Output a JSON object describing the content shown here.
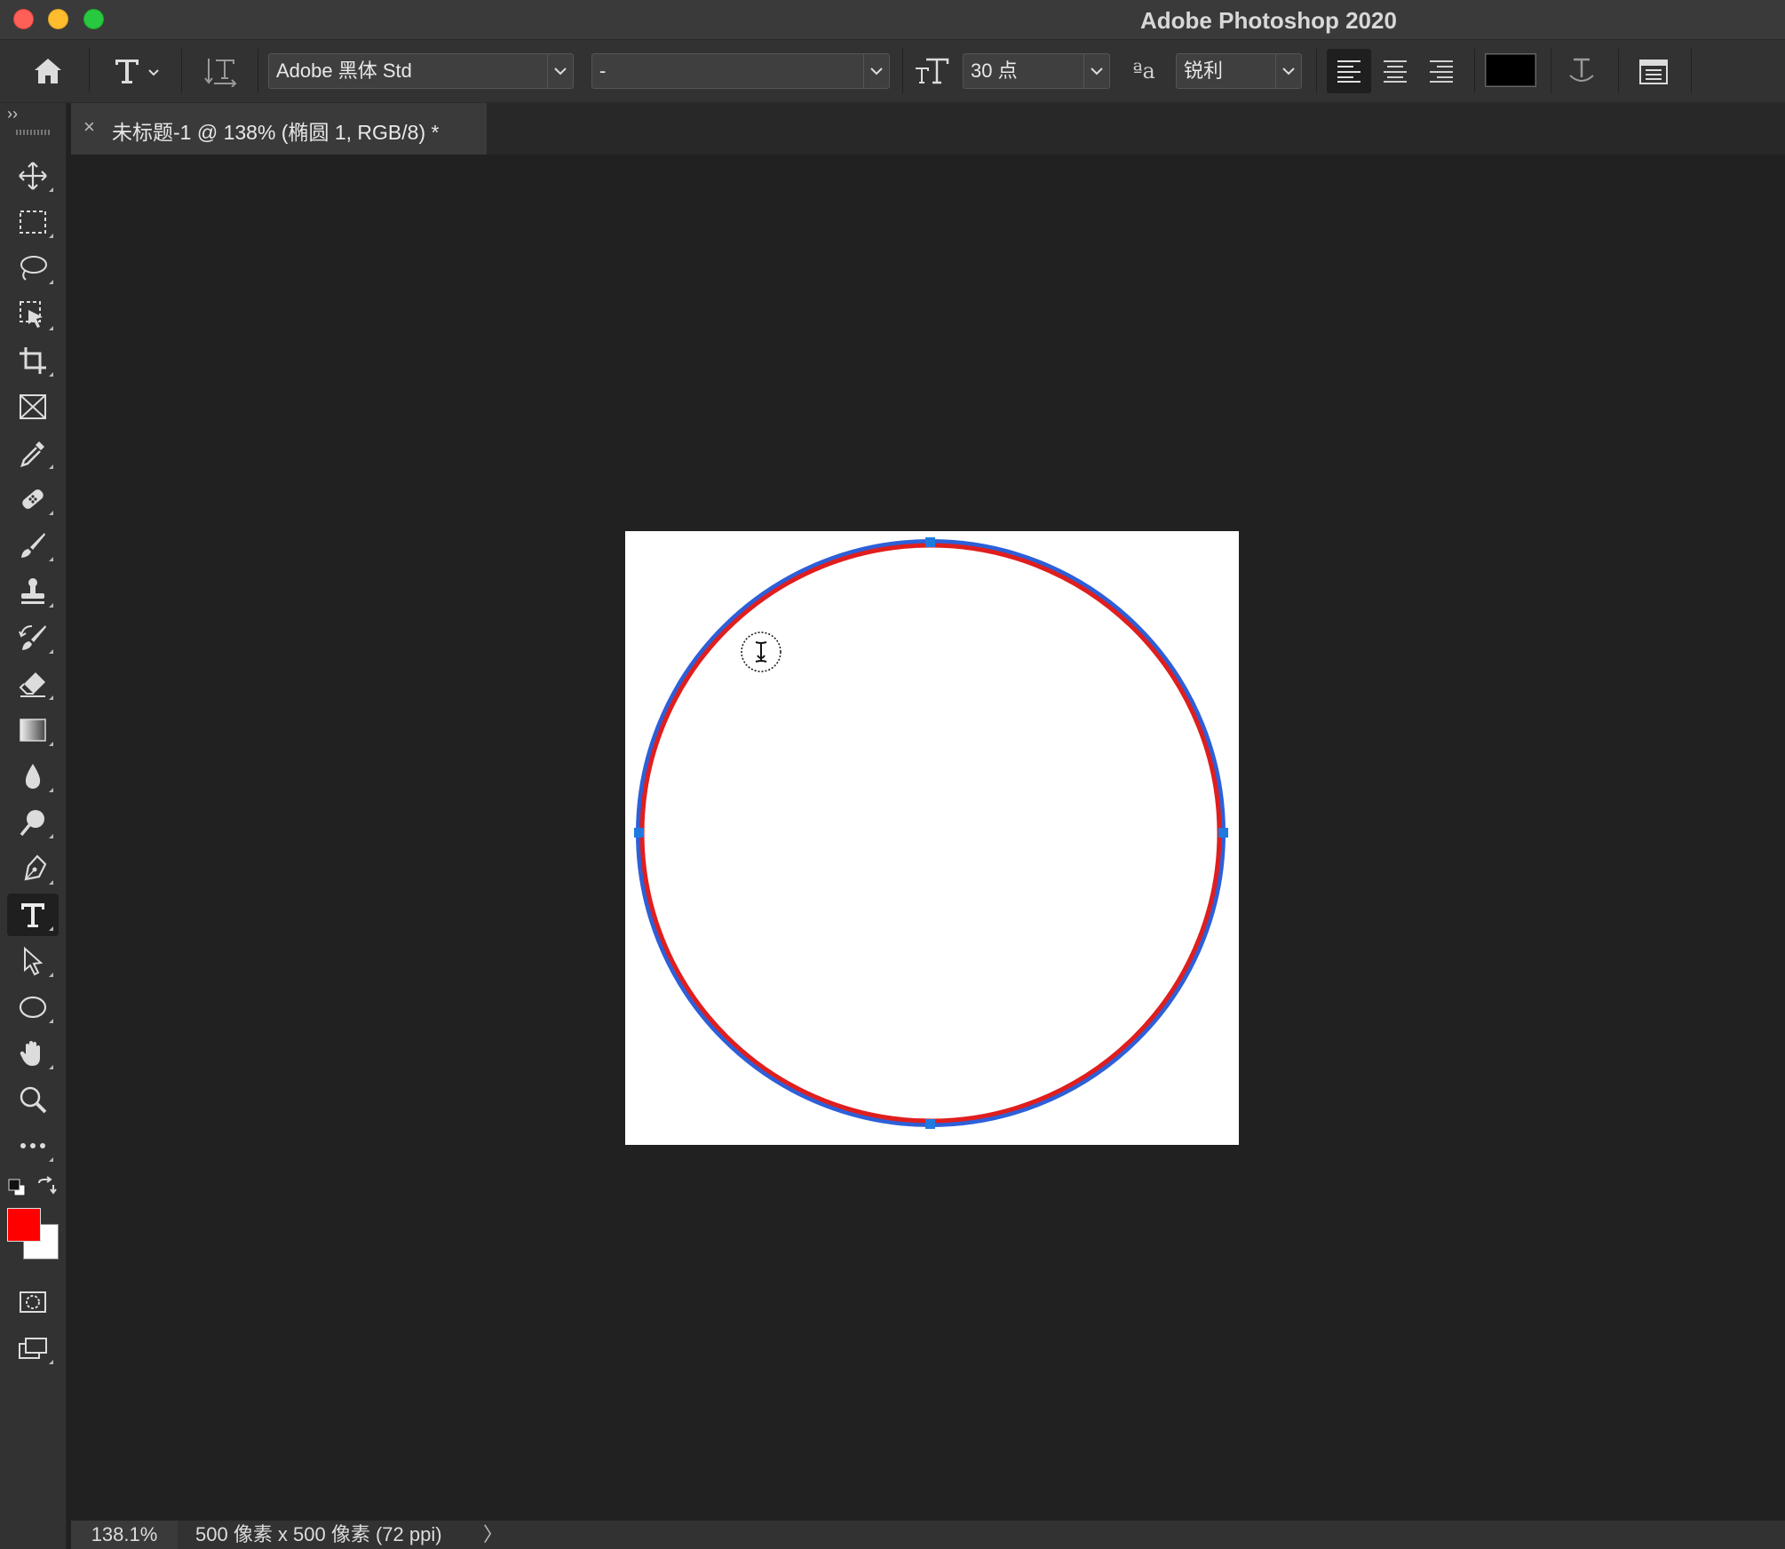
{
  "window": {
    "title": "Adobe Photoshop 2020"
  },
  "options_bar": {
    "font_family": "Adobe 黑体 Std",
    "font_style": "-",
    "font_size": "30 点",
    "antialias": "锐利",
    "text_color": "#000000"
  },
  "document_tab": {
    "close_glyph": "×",
    "title": "未标题-1 @ 138% (椭圆 1, RGB/8) *"
  },
  "toolbar": {
    "collapse_glyph": "››",
    "tools": [
      {
        "name": "move-tool",
        "icon": "move-icon"
      },
      {
        "name": "marquee-tool",
        "icon": "rect-marquee-icon"
      },
      {
        "name": "lasso-tool",
        "icon": "lasso-icon"
      },
      {
        "name": "object-select-tool",
        "icon": "object-select-icon"
      },
      {
        "name": "crop-tool",
        "icon": "crop-icon"
      },
      {
        "name": "frame-tool",
        "icon": "frame-icon"
      },
      {
        "name": "eyedropper-tool",
        "icon": "eyedropper-icon"
      },
      {
        "name": "healing-brush-tool",
        "icon": "bandage-icon"
      },
      {
        "name": "brush-tool",
        "icon": "brush-icon"
      },
      {
        "name": "clone-stamp-tool",
        "icon": "stamp-icon"
      },
      {
        "name": "history-brush-tool",
        "icon": "history-brush-icon"
      },
      {
        "name": "eraser-tool",
        "icon": "eraser-icon"
      },
      {
        "name": "gradient-tool",
        "icon": "gradient-icon"
      },
      {
        "name": "blur-tool",
        "icon": "drop-icon"
      },
      {
        "name": "dodge-tool",
        "icon": "dodge-icon"
      },
      {
        "name": "pen-tool",
        "icon": "pen-icon"
      },
      {
        "name": "type-tool",
        "icon": "type-icon",
        "active": true
      },
      {
        "name": "path-select-tool",
        "icon": "arrow-icon"
      },
      {
        "name": "ellipse-tool",
        "icon": "ellipse-icon"
      },
      {
        "name": "hand-tool",
        "icon": "hand-icon"
      },
      {
        "name": "zoom-tool",
        "icon": "magnifier-icon"
      },
      {
        "name": "edit-toolbar",
        "icon": "more-icon"
      }
    ],
    "foreground_color": "#ff0000",
    "background_color": "#ffffff"
  },
  "canvas": {
    "ellipse_stroke_color": "#e01e1e",
    "path_color": "#2d5fd8",
    "handle_color": "#1f7ae0"
  },
  "status_bar": {
    "zoom": "138.1%",
    "doc_info": "500 像素 x 500 像素 (72 ppi)",
    "arrow": "〉"
  }
}
